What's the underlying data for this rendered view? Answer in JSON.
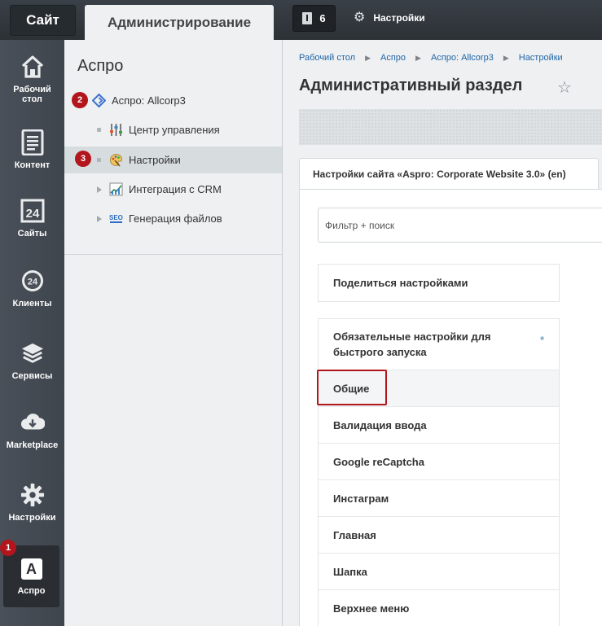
{
  "topbar": {
    "tab_site": "Сайт",
    "tab_admin": "Администрирование",
    "notifications_count": "6",
    "settings_label": "Настройки"
  },
  "sidebar": {
    "items": [
      {
        "label": "Рабочий стол",
        "icon": "home-icon"
      },
      {
        "label": "Контент",
        "icon": "document-icon"
      },
      {
        "label": "Сайты",
        "icon": "calendar-24-icon"
      },
      {
        "label": "Клиенты",
        "icon": "clients-24-icon"
      },
      {
        "label": "Сервисы",
        "icon": "layers-icon"
      },
      {
        "label": "Marketplace",
        "icon": "cloud-download-icon"
      },
      {
        "label": "Настройки",
        "icon": "gear-icon"
      },
      {
        "label": "Аспро",
        "icon": "aspro-a-icon",
        "glyph": "A"
      }
    ]
  },
  "tree": {
    "title": "Аспро",
    "root": "Аспро: Allcorp3",
    "items": [
      {
        "label": "Центр управления",
        "icon": "sliders-icon"
      },
      {
        "label": "Настройки",
        "icon": "palette-icon"
      },
      {
        "label": "Интеграция с CRM",
        "icon": "chart-icon"
      },
      {
        "label": "Генерация файлов",
        "icon": "seo-icon"
      }
    ]
  },
  "badges": [
    "1",
    "2",
    "3"
  ],
  "main": {
    "breadcrumbs": [
      "Рабочий стол",
      "Аспро",
      "Аспро: Allcorp3",
      "Настройки"
    ],
    "title": "Административный раздел",
    "tab_label": "Настройки сайта «Aspro: Corporate Website 3.0» (en)",
    "filter_placeholder": "Фильтр + поиск",
    "share_label": "Поделиться настройками",
    "menu": [
      "Обязательные настройки для быстрого запуска",
      "Общие",
      "Валидация ввода",
      "Google reCaptcha",
      "Инстаграм",
      "Главная",
      "Шапка",
      "Верхнее меню"
    ]
  },
  "colors": {
    "topbar": "#30353b",
    "sidebar": "#454b53",
    "panel": "#eef0f1",
    "badge": "#b2151b",
    "link": "#2066a8"
  }
}
